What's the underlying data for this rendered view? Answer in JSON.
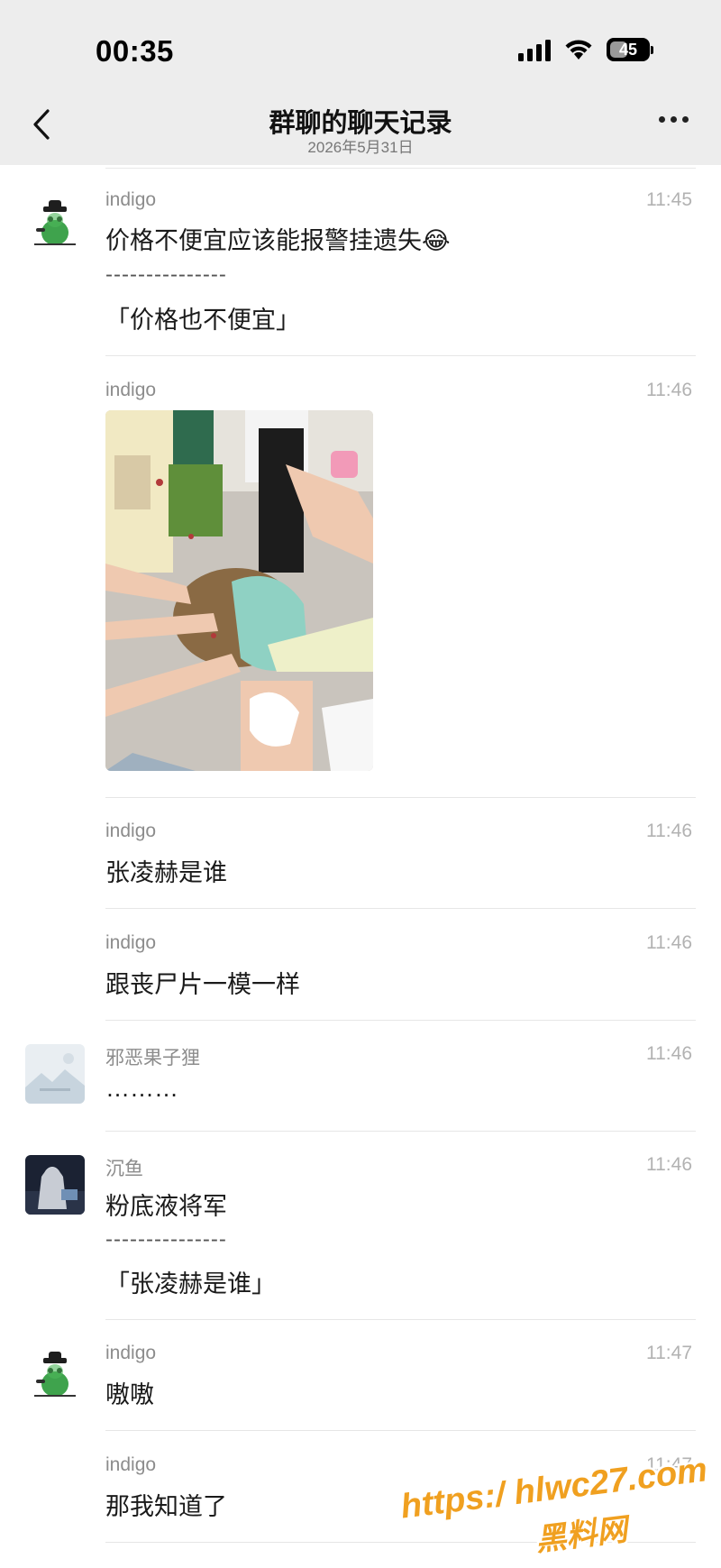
{
  "status_bar": {
    "time": "00:35",
    "battery_level": "45",
    "icons": [
      "cellular-signal-icon",
      "wifi-icon",
      "battery-icon"
    ]
  },
  "nav": {
    "title": "群聊的聊天记录",
    "subtitle": "2026年5月31日",
    "back_icon": "chevron-left-icon",
    "more_icon": "ellipsis-icon"
  },
  "messages": [
    {
      "sender": "indigo",
      "time": "11:45",
      "text": "价格不便宜应该能报警挂遗失😂",
      "quote_separator": "---------------",
      "quote": "「价格也不便宜」"
    },
    {
      "sender": "indigo",
      "time": "11:46",
      "type": "image",
      "image_desc": "photo"
    },
    {
      "sender": "indigo",
      "time": "11:46",
      "text": "张凌赫是谁"
    },
    {
      "sender": "indigo",
      "time": "11:46",
      "text": "跟丧尸片一模一样"
    },
    {
      "sender": "邪恶果子狸",
      "time": "11:46",
      "text": "………"
    },
    {
      "sender": "沉鱼",
      "time": "11:46",
      "text": "粉底液将军",
      "quote_separator": "---------------",
      "quote": "「张凌赫是谁」"
    },
    {
      "sender": "indigo",
      "time": "11:47",
      "text": "嗷嗷"
    },
    {
      "sender": "indigo",
      "time": "11:47",
      "text": "那我知道了"
    }
  ],
  "watermark": {
    "url": "https:/ hlwc27.com",
    "name": "黑料网"
  },
  "colors": {
    "bar_bg": "#ededed",
    "text": "#1a1a1a",
    "meta": "#8c8c8c",
    "watermark": "#f0a020"
  }
}
